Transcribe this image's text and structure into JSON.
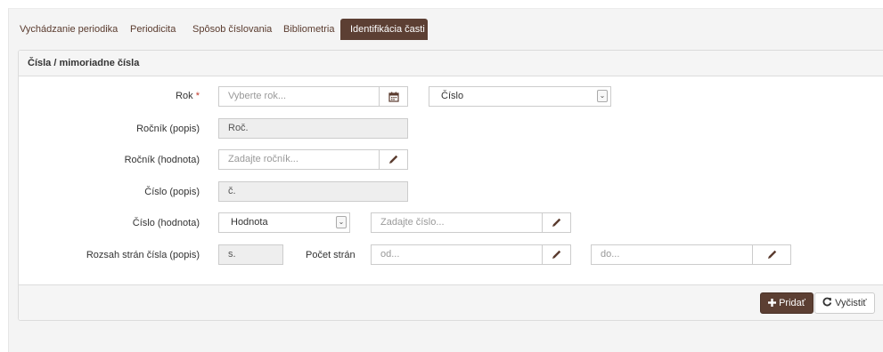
{
  "tabs": [
    {
      "label": "Vychádzanie periodika"
    },
    {
      "label": "Periodicita"
    },
    {
      "label": "Spôsob číslovania"
    },
    {
      "label": "Bibliometria"
    },
    {
      "label": "Identifikácia časti"
    }
  ],
  "panel": {
    "title": "Čísla / mimoriadne čísla"
  },
  "form": {
    "rok": {
      "label": "Rok",
      "required_mark": "*",
      "placeholder": "Vyberte rok...",
      "type_select_value": "Číslo"
    },
    "rocnik_popis": {
      "label": "Ročník (popis)",
      "value": "Roč."
    },
    "rocnik_hodnota": {
      "label": "Ročník (hodnota)",
      "placeholder": "Zadajte ročník..."
    },
    "cislo_popis": {
      "label": "Číslo (popis)",
      "value": "č."
    },
    "cislo_hodnota": {
      "label": "Číslo (hodnota)",
      "select_value": "Hodnota",
      "placeholder": "Zadajte číslo..."
    },
    "rozsah": {
      "label": "Rozsah strán čísla (popis)",
      "value": "s.",
      "pocet_label": "Počet strán",
      "od_placeholder": "od...",
      "do_placeholder": "do..."
    }
  },
  "footer": {
    "add_label": "Pridať",
    "clear_label": "Vyčistiť"
  },
  "icons": {
    "calendar": "calendar-icon",
    "pencil": "pencil-icon",
    "plus": "plus-icon",
    "refresh": "refresh-icon",
    "chevron": "chevron-down-icon"
  },
  "colors": {
    "accent": "#5c3f33",
    "tab_text": "#5a3b2e",
    "required": "#c0392b"
  }
}
